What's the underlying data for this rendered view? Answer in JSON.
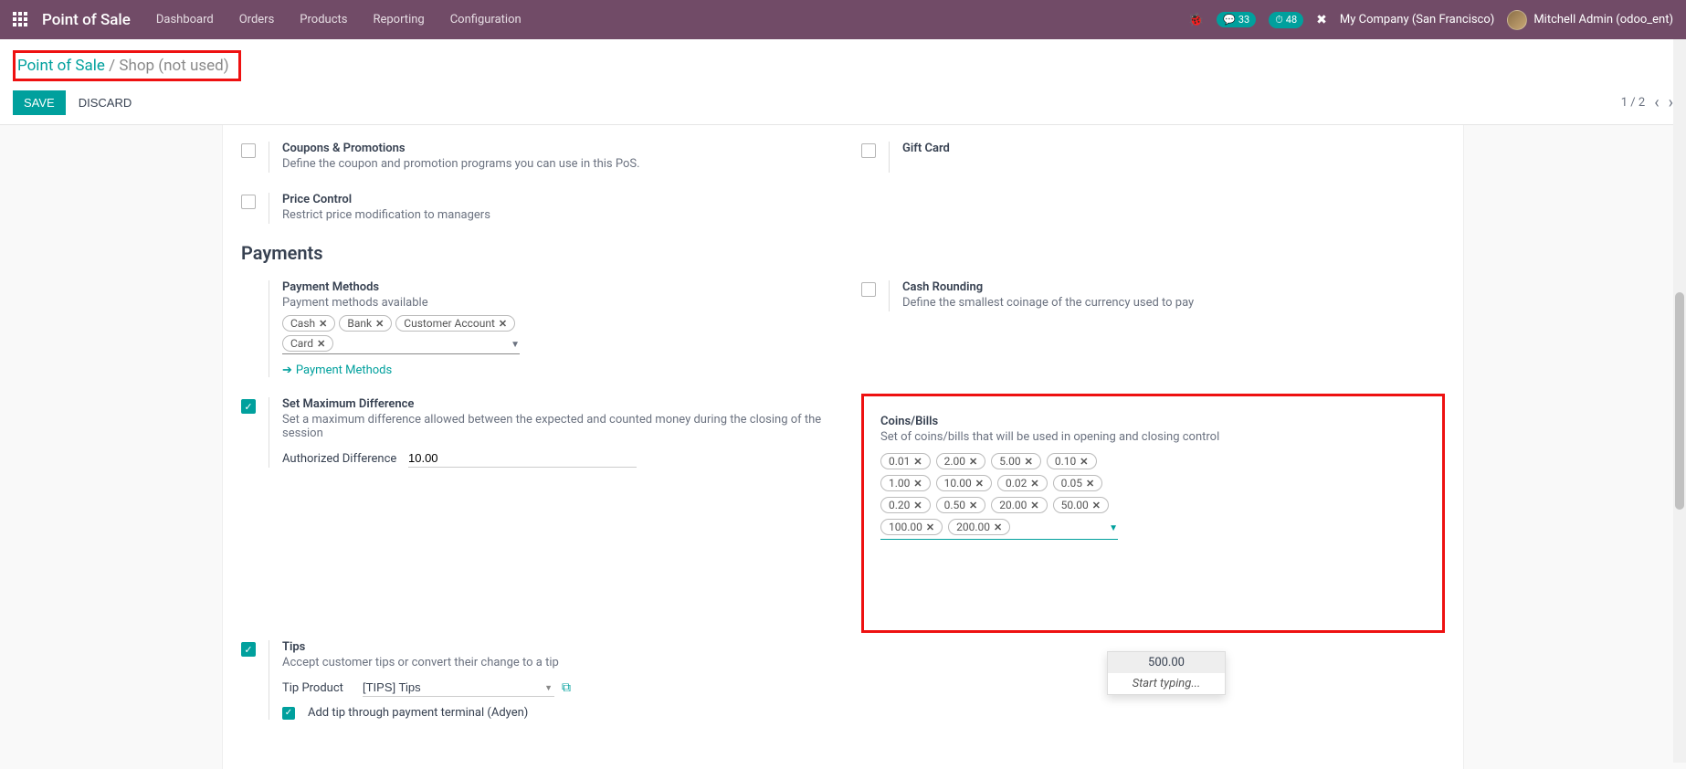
{
  "brand": "Point of Sale",
  "nav": {
    "dashboard": "Dashboard",
    "orders": "Orders",
    "products": "Products",
    "reporting": "Reporting",
    "configuration": "Configuration"
  },
  "badges": {
    "msg": "33",
    "activity": "48"
  },
  "company": "My Company (San Francisco)",
  "user": "Mitchell Admin (odoo_ent)",
  "breadcrumb": {
    "root": "Point of Sale",
    "sep": " / ",
    "leaf": "Shop (not used)"
  },
  "buttons": {
    "save": "SAVE",
    "discard": "DISCARD"
  },
  "pager": "1 / 2",
  "settings": {
    "coupons": {
      "title": "Coupons & Promotions",
      "desc": "Define the coupon and promotion programs you can use in this PoS."
    },
    "giftcard": {
      "title": "Gift Card"
    },
    "pricecontrol": {
      "title": "Price Control",
      "desc": "Restrict price modification to managers"
    },
    "section": "Payments",
    "paymethods": {
      "title": "Payment Methods",
      "desc": "Payment methods available",
      "tags": [
        "Cash",
        "Bank",
        "Customer Account",
        "Card"
      ],
      "link": "Payment Methods"
    },
    "cashround": {
      "title": "Cash Rounding",
      "desc": "Define the smallest coinage of the currency used to pay"
    },
    "maxdiff": {
      "title": "Set Maximum Difference",
      "desc": "Set a maximum difference allowed between the expected and counted money during the closing of the session",
      "field_label": "Authorized Difference",
      "field_value": "10.00"
    },
    "coins": {
      "title": "Coins/Bills",
      "desc": "Set of coins/bills that will be used in opening and closing control",
      "tags": [
        "0.01",
        "2.00",
        "5.00",
        "0.10",
        "1.00",
        "10.00",
        "0.02",
        "0.05",
        "0.20",
        "0.50",
        "20.00",
        "50.00",
        "100.00",
        "200.00"
      ]
    },
    "tips": {
      "title": "Tips",
      "desc": "Accept customer tips or convert their change to a tip",
      "field_label": "Tip Product",
      "field_value": "[TIPS] Tips",
      "addtip": "Add tip through payment terminal (Adyen)"
    }
  },
  "dropdown": {
    "option": "500.00",
    "hint": "Start typing..."
  }
}
